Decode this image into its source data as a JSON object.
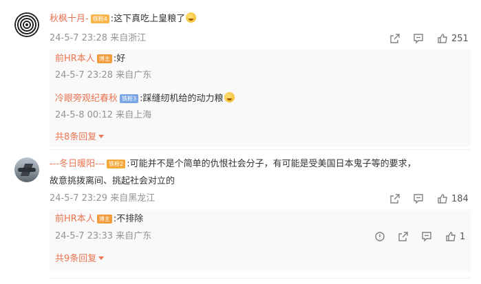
{
  "comments": [
    {
      "username": "秋枫十月-",
      "badge": "铁粉4",
      "text": ":这下真吃上皇粮了",
      "emoji": "doge",
      "date": "24-5-7 23:28",
      "location": "来自浙江",
      "likes": "251",
      "replies": [
        {
          "username": "前HR本人",
          "badge": "博主",
          "text": ":好",
          "date": "24-5-7 23:28",
          "location": "来自广东"
        },
        {
          "username": "冷眼旁观纪春秋",
          "badge": "铁粉3",
          "text": ":踩缝纫机给的动力粮",
          "emoji": "doge",
          "date": "24-5-8 00:12",
          "location": "来自上海"
        }
      ],
      "expand_label": "共8条回复"
    },
    {
      "username": "---冬日暖阳---",
      "badge": "铁粉2",
      "text_line1": ":可能并不是个简单的仇恨社会分子，有可能是受美国日本鬼子等的要求，",
      "text_line2": "故意挑拨离间、挑起社会对立的",
      "date": "24-5-7 23:29",
      "location": "来自黑龙江",
      "likes": "184",
      "replies": [
        {
          "username": "前HR本人",
          "badge": "博主",
          "text": ":不排除",
          "date": "24-5-7 23:33",
          "location": "来自广东",
          "likes": "1"
        }
      ],
      "expand_label": "共9条回复"
    }
  ],
  "icons": {
    "share": "share-icon",
    "comment": "comment-icon",
    "like": "like-icon",
    "report": "report-icon"
  },
  "colors": {
    "username": "#eb7350",
    "meta": "#939393",
    "reply_bg": "#f9f9f9"
  }
}
